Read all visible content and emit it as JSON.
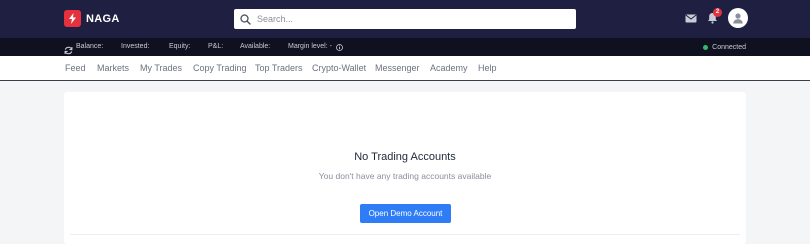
{
  "header": {
    "brand": "NAGA",
    "search_placeholder": "Search...",
    "notification_count": "2",
    "icons": [
      "lightning-logo-icon",
      "search-icon",
      "mail-icon",
      "bell-icon",
      "user-avatar-icon"
    ]
  },
  "account_bar": {
    "balance_label": "Balance:",
    "invested_label": "Invested:",
    "equity_label": "Equity:",
    "pnl_label": "P&L:",
    "available_label": "Available:",
    "margin_label": "Margin level: -",
    "status_label": "Connected",
    "status_color": "#2ebd6b"
  },
  "nav": {
    "items": [
      "Feed",
      "Markets",
      "My Trades",
      "Copy Trading",
      "Top Traders",
      "Crypto-Wallet",
      "Messenger",
      "Academy",
      "Help"
    ]
  },
  "main": {
    "empty_title": "No Trading Accounts",
    "empty_subtitle": "You don't have any trading accounts available",
    "demo_button": "Open Demo Account"
  },
  "colors": {
    "header_bg": "#1f2041",
    "status_bg": "#0f1020",
    "brand_red": "#e5313d",
    "primary_blue": "#2f7df6"
  }
}
